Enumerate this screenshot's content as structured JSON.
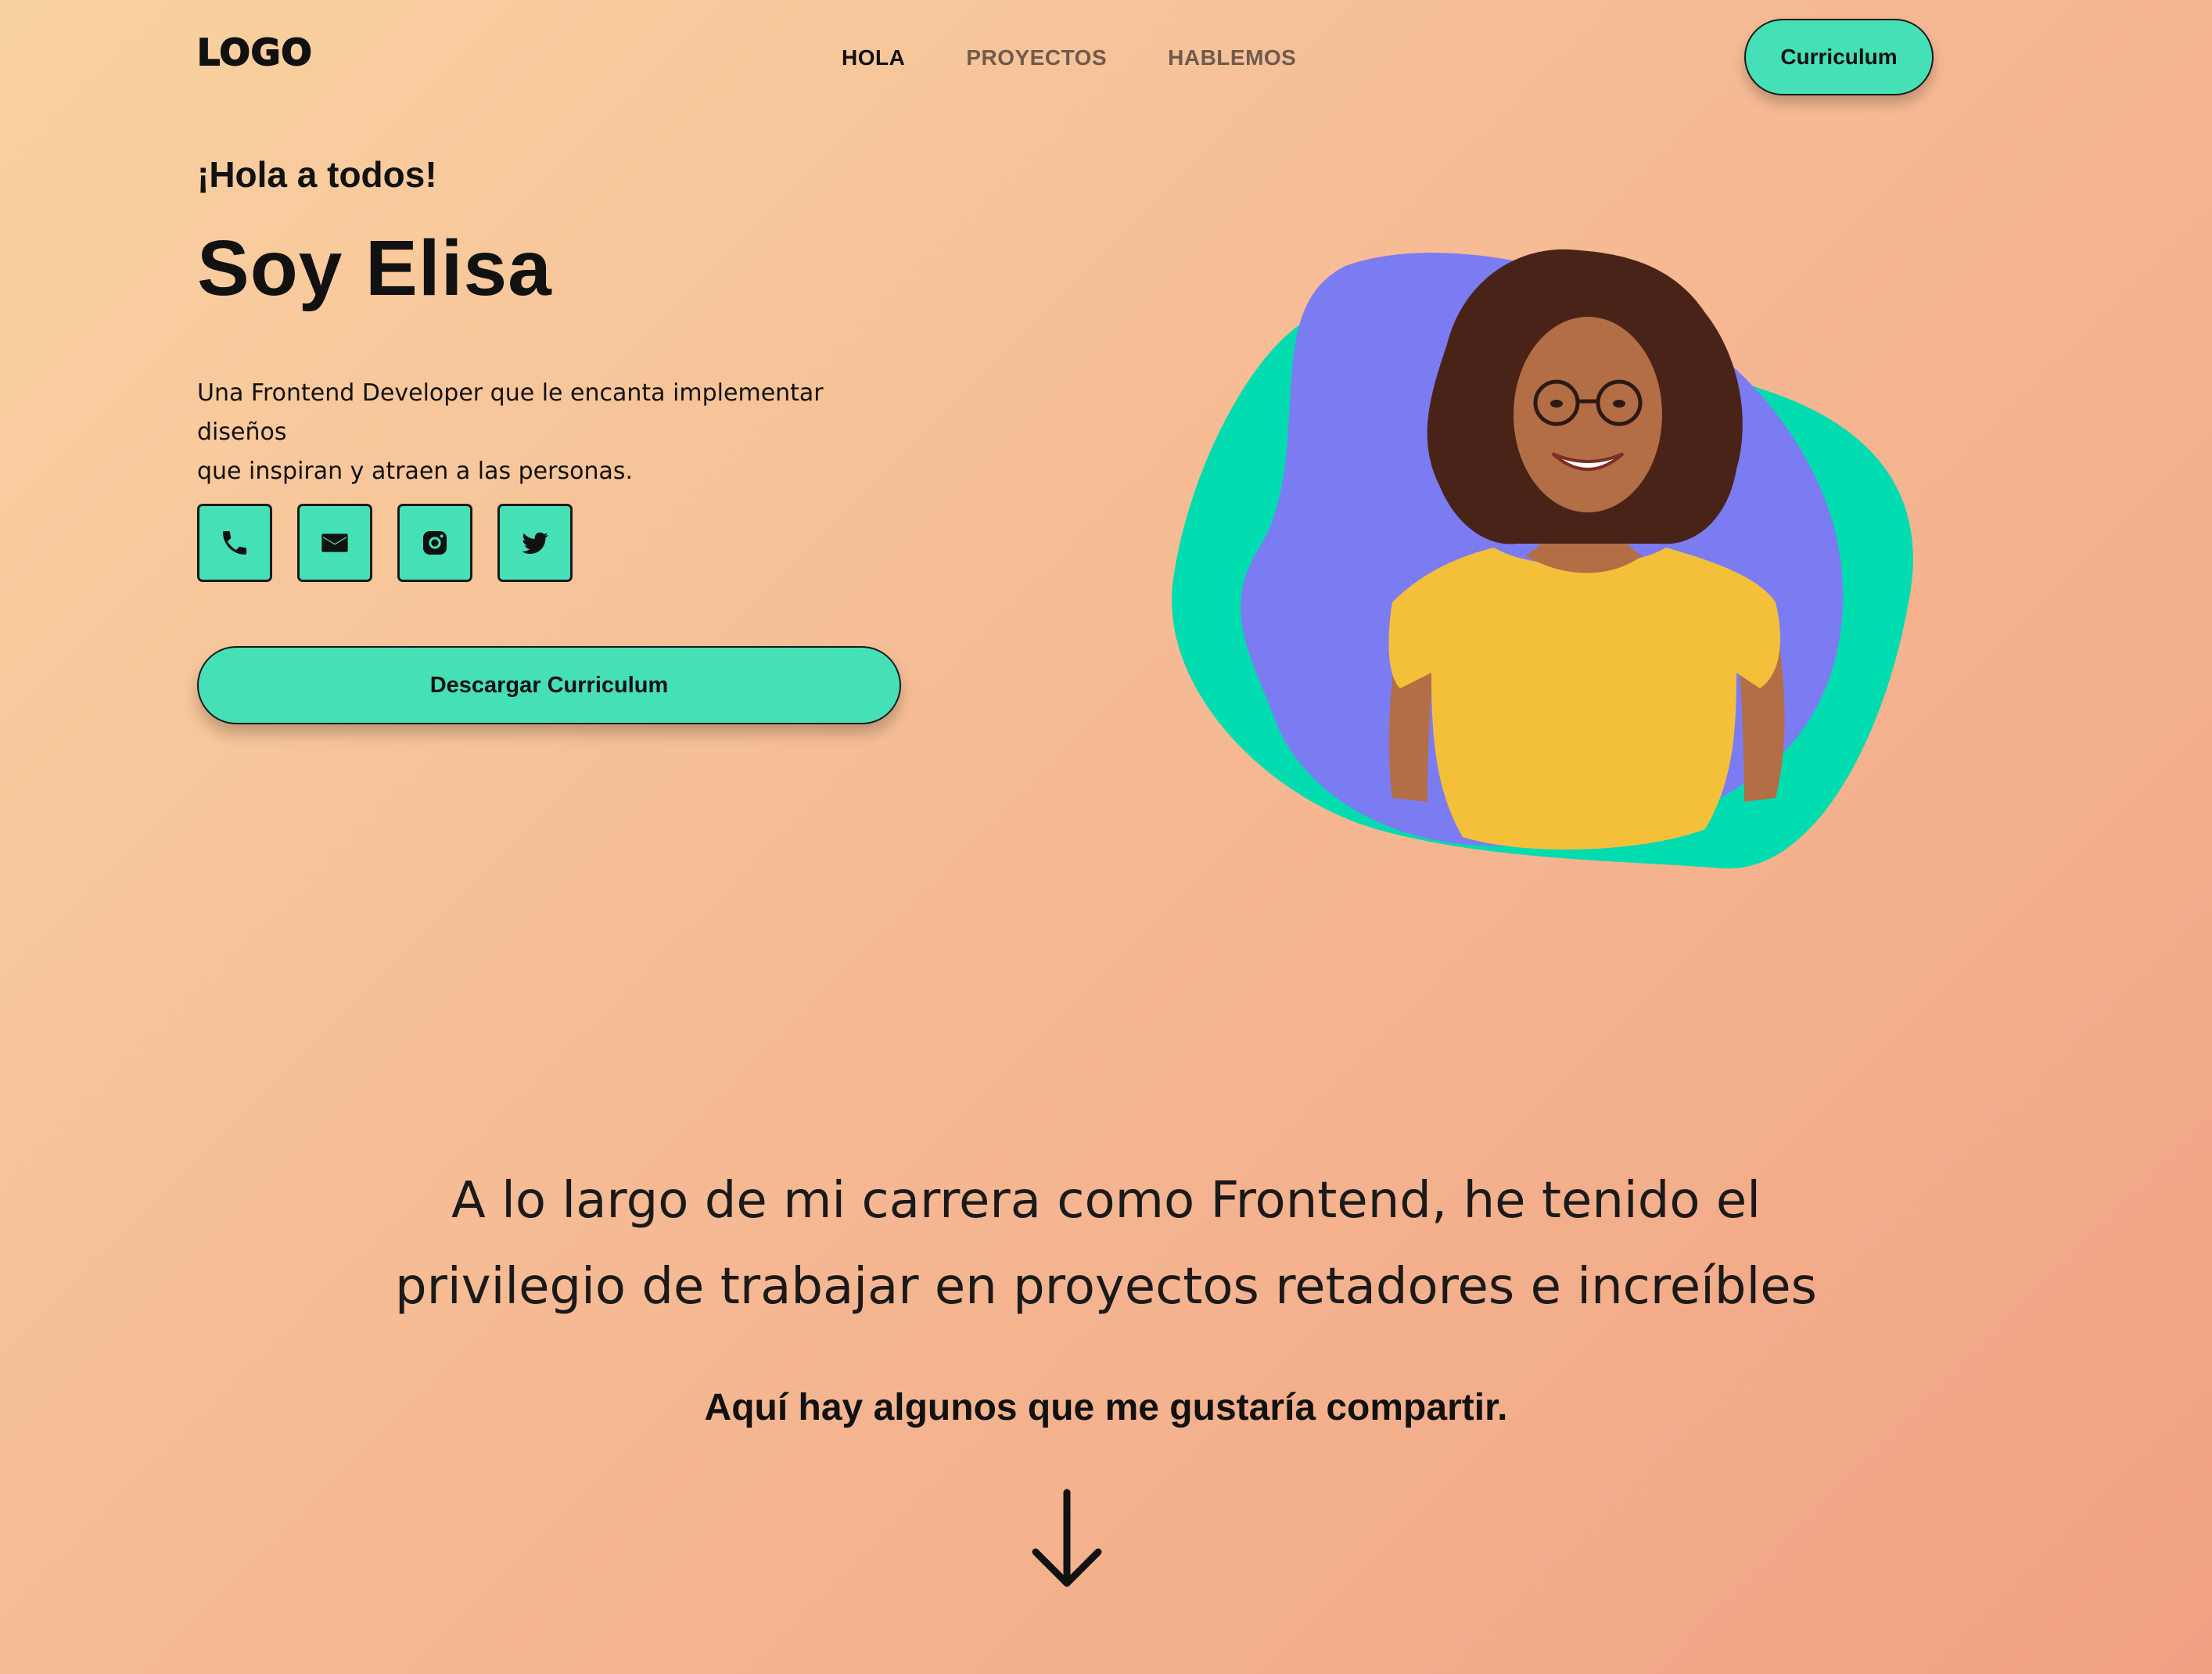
{
  "nav": {
    "logo": "LOGO",
    "links": [
      {
        "label": "HOLA",
        "active": true
      },
      {
        "label": "PROYECTOS",
        "active": false
      },
      {
        "label": "HABLEMOS",
        "active": false
      }
    ],
    "cta_label": "Curriculum"
  },
  "hero": {
    "greeting": "¡Hola a todos!",
    "name": "Soy Elisa",
    "description_line1": "Una Frontend Developer que le encanta implementar diseños",
    "description_line2": "que inspiran y atraen a las personas.",
    "socials": [
      {
        "icon": "phone-icon"
      },
      {
        "icon": "mail-icon"
      },
      {
        "icon": "instagram-icon"
      },
      {
        "icon": "twitter-icon"
      }
    ],
    "download_label": "Descargar Curriculum"
  },
  "intro": {
    "line1": "A lo largo de mi carrera como Frontend, he tenido el",
    "line2": "privilegio de trabajar en proyectos retadores e increíbles",
    "share": "Aquí hay algunos que me gustaría compartir.",
    "arrow_icon": "arrow-down-icon"
  },
  "colors": {
    "accent": "#45e0b6",
    "blob_green": "#00dbb0",
    "blob_purple": "#7b7cf2",
    "bg_start": "#f9d2a1",
    "bg_end": "#f1a283"
  }
}
